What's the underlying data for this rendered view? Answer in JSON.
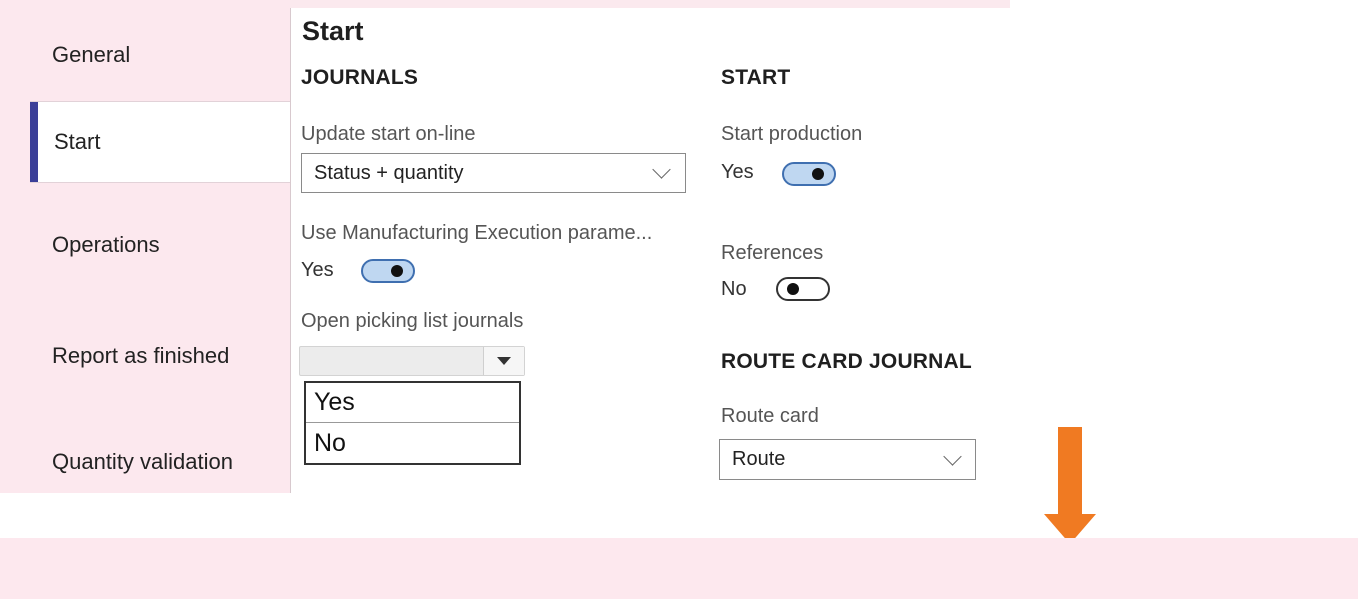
{
  "sidebar": {
    "tabs": [
      {
        "label": "General"
      },
      {
        "label": "Start"
      },
      {
        "label": "Operations"
      },
      {
        "label": "Report as finished"
      },
      {
        "label": "Quantity validation"
      }
    ]
  },
  "page": {
    "title": "Start"
  },
  "journals": {
    "heading": "JOURNALS",
    "update_start_online": {
      "label": "Update start on-line",
      "value": "Status + quantity"
    },
    "use_mes_params": {
      "label": "Use Manufacturing Execution parame...",
      "value": "Yes"
    },
    "open_picking_list": {
      "label": "Open picking list journals",
      "value": "",
      "options": [
        "Yes",
        "No"
      ]
    }
  },
  "start_section": {
    "heading": "START",
    "start_production": {
      "label": "Start production",
      "value": "Yes"
    },
    "references": {
      "label": "References",
      "value": "No"
    }
  },
  "route_card_journal": {
    "heading": "ROUTE CARD JOURNAL",
    "route_card": {
      "label": "Route card",
      "value": "Route"
    }
  },
  "colors": {
    "sidebar_bg": "#fce8ee",
    "active_tab_marker": "#3b3f98",
    "toggle_on_fill": "#bfd7f1",
    "arrow": "#f07a22"
  },
  "icons": [
    "chevron-down-icon",
    "dropdown-triangle-icon",
    "down-arrow-icon"
  ]
}
